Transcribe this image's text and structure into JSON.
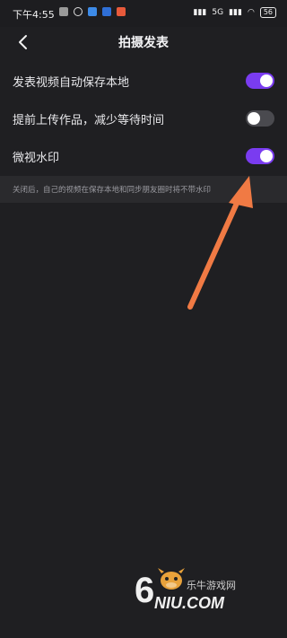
{
  "statusbar": {
    "time": "下午4:55",
    "network_label": "5G",
    "battery": "56"
  },
  "header": {
    "title": "拍摄发表",
    "back_icon": "chevron-left-icon"
  },
  "settings": [
    {
      "label": "发表视频自动保存本地",
      "enabled": true
    },
    {
      "label": "提前上传作品，减少等待时间",
      "enabled": false
    },
    {
      "label": "微视水印",
      "enabled": true
    }
  ],
  "hint": {
    "text": "关闭后，自己的视频在保存本地和同步朋友圈时将不带水印"
  },
  "annotation": {
    "arrow_color": "#f07a44"
  },
  "watermark": {
    "number": "6",
    "site_cn": "乐牛游戏网",
    "domain": "NIU.COM"
  },
  "colors": {
    "background": "#1f1f22",
    "toggle_on": "#7a3cf0",
    "toggle_off": "#4a4a4f"
  }
}
